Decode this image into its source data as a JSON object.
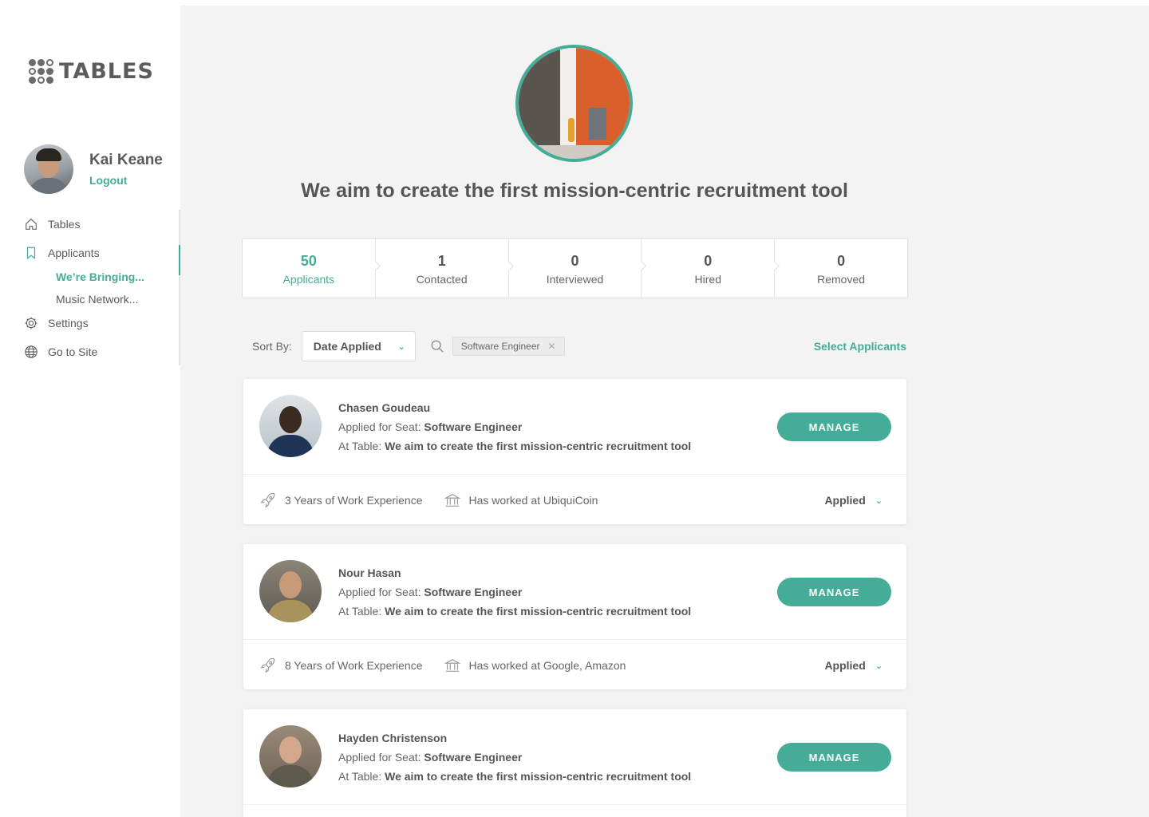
{
  "brand": {
    "name": "TABLES"
  },
  "user": {
    "name": "Kai Keane",
    "logout_label": "Logout"
  },
  "nav": {
    "tables": "Tables",
    "applicants": "Applicants",
    "sub": [
      "We’re Bringing...",
      "Music Network..."
    ],
    "settings": "Settings",
    "go_to_site": "Go to Site"
  },
  "headline": "We aim to create the first mission-centric recruitment tool",
  "stats": [
    {
      "value": "50",
      "label": "Applicants"
    },
    {
      "value": "1",
      "label": "Contacted"
    },
    {
      "value": "0",
      "label": "Interviewed"
    },
    {
      "value": "0",
      "label": "Hired"
    },
    {
      "value": "0",
      "label": "Removed"
    }
  ],
  "toolbar": {
    "sort_label": "Sort By:",
    "sort_value": "Date Applied",
    "filter_tag": "Software Engineer",
    "select_label": "Select Applicants"
  },
  "applicants": [
    {
      "name": "Chasen Goudeau",
      "seat_prefix": "Applied for Seat:",
      "seat": "Software Engineer",
      "table_prefix": "At Table:",
      "table": "We aim to create the first mission-centric recruitment tool",
      "manage_label": "MANAGE",
      "experience": "3 Years of Work Experience",
      "worked_at": "Has worked at UbiquiCoin",
      "status": "Applied"
    },
    {
      "name": "Nour Hasan",
      "seat_prefix": "Applied for Seat:",
      "seat": "Software Engineer",
      "table_prefix": "At Table:",
      "table": "We aim to create the first mission-centric recruitment tool",
      "manage_label": "MANAGE",
      "experience": "8 Years of Work Experience",
      "worked_at": "Has worked at Google, Amazon",
      "status": "Applied"
    },
    {
      "name": "Hayden Christenson",
      "seat_prefix": "Applied for Seat:",
      "seat": "Software Engineer",
      "table_prefix": "At Table:",
      "table": "We aim to create the first mission-centric recruitment tool",
      "manage_label": "MANAGE"
    }
  ],
  "colors": {
    "accent": "#45ad97",
    "background": "#f3f3f3",
    "text": "#4a4a4a"
  }
}
